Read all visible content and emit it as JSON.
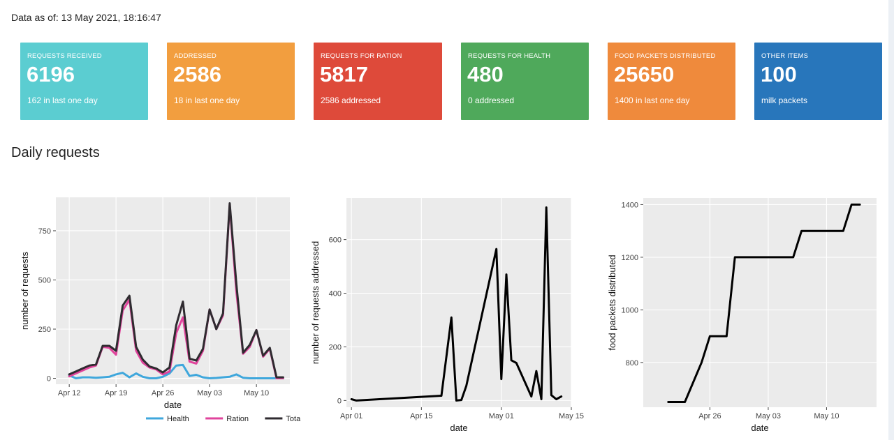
{
  "data_as_of": "Data as of: 13 May 2021, 18:16:47",
  "section_title": "Daily requests",
  "boxes": [
    {
      "label": "REQUESTS RECEIVED",
      "value": "6196",
      "sub": "162 in last one day",
      "color": "#5bcdd1"
    },
    {
      "label": "ADDRESSED",
      "value": "2586",
      "sub": "18 in last one day",
      "color": "#f29e3f"
    },
    {
      "label": "REQUESTS FOR RATION",
      "value": "5817",
      "sub": "2586 addressed",
      "color": "#de4a3a"
    },
    {
      "label": "REQUESTS FOR HEALTH",
      "value": "480",
      "sub": "0 addressed",
      "color": "#4fa95b"
    },
    {
      "label": "FOOD PACKETS DISTRIBUTED",
      "value": "25650",
      "sub": "1400 in last one day",
      "color": "#ef8a3c"
    },
    {
      "label": "OTHER ITEMS",
      "value": "100",
      "sub": "milk packets",
      "color": "#2876bb"
    }
  ],
  "chart_data": [
    {
      "type": "line",
      "xlabel": "date",
      "ylabel": "number of requests",
      "x_ticks": [
        "Apr 12",
        "Apr 19",
        "Apr 26",
        "May 03",
        "May 10"
      ],
      "y_ticks": [
        "0",
        "250",
        "500",
        "750"
      ],
      "ylim": [
        -30,
        920
      ],
      "x": [
        "Apr 12",
        "Apr 13",
        "Apr 14",
        "Apr 15",
        "Apr 16",
        "Apr 17",
        "Apr 18",
        "Apr 19",
        "Apr 20",
        "Apr 21",
        "Apr 22",
        "Apr 23",
        "Apr 24",
        "Apr 25",
        "Apr 26",
        "Apr 27",
        "Apr 28",
        "Apr 29",
        "Apr 30",
        "May 01",
        "May 02",
        "May 03",
        "May 04",
        "May 05",
        "May 06",
        "May 07",
        "May 08",
        "May 09",
        "May 10",
        "May 11",
        "May 12",
        "May 13",
        "May 14"
      ],
      "series": [
        {
          "name": "Health",
          "color": "#3fa7dc",
          "values": [
            15,
            0,
            5,
            5,
            3,
            5,
            8,
            20,
            28,
            5,
            25,
            8,
            0,
            0,
            8,
            25,
            65,
            68,
            12,
            18,
            5,
            0,
            2,
            5,
            8,
            20,
            3,
            0,
            0,
            0,
            0,
            0,
            0
          ]
        },
        {
          "name": "Ration",
          "color": "#e0449c",
          "values": [
            10,
            25,
            40,
            55,
            65,
            160,
            155,
            120,
            345,
            400,
            140,
            80,
            55,
            45,
            20,
            35,
            230,
            310,
            85,
            75,
            140,
            350,
            250,
            320,
            880,
            440,
            125,
            160,
            245,
            110,
            150,
            0,
            0
          ]
        },
        {
          "name": "Total",
          "color": "#2f2b30",
          "values": [
            20,
            35,
            50,
            65,
            70,
            165,
            165,
            140,
            370,
            420,
            160,
            95,
            60,
            50,
            30,
            55,
            270,
            390,
            100,
            90,
            150,
            350,
            250,
            330,
            890,
            480,
            130,
            170,
            245,
            115,
            155,
            5,
            5
          ]
        }
      ],
      "legend": [
        "Health",
        "Ration",
        "Total"
      ]
    },
    {
      "type": "line",
      "xlabel": "date",
      "ylabel": "number of requests addressed",
      "x_ticks": [
        "Apr 01",
        "Apr 15",
        "May 01",
        "May 15"
      ],
      "y_ticks": [
        "0",
        "200",
        "400",
        "600"
      ],
      "ylim": [
        -25,
        755
      ],
      "x": [
        "Apr 01",
        "Apr 02",
        "Apr 19",
        "Apr 21",
        "Apr 22",
        "Apr 23",
        "Apr 24",
        "Apr 30",
        "May 01",
        "May 02",
        "May 03",
        "May 04",
        "May 07",
        "May 08",
        "May 09",
        "May 10",
        "May 11",
        "May 12",
        "May 13"
      ],
      "values": [
        5,
        0,
        18,
        310,
        0,
        2,
        55,
        565,
        80,
        470,
        150,
        140,
        15,
        110,
        5,
        720,
        20,
        5,
        15
      ]
    },
    {
      "type": "line",
      "xlabel": "date",
      "ylabel": "food packets distributed",
      "x_ticks": [
        "Apr 26",
        "May 03",
        "May 10"
      ],
      "y_ticks": [
        "800",
        "1000",
        "1200",
        "1400"
      ],
      "ylim": [
        630,
        1425
      ],
      "x": [
        "Apr 21",
        "Apr 23",
        "Apr 25",
        "Apr 26",
        "Apr 28",
        "Apr 29",
        "May 06",
        "May 07",
        "May 12",
        "May 13",
        "May 14"
      ],
      "values": [
        650,
        650,
        800,
        900,
        900,
        1200,
        1200,
        1300,
        1300,
        1400,
        1400
      ]
    }
  ]
}
